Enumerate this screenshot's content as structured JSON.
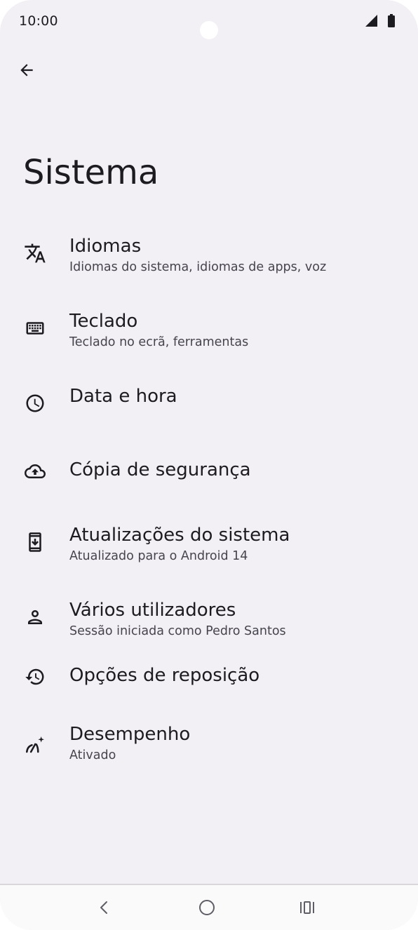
{
  "status_bar": {
    "time": "10:00",
    "icons": [
      "signal-icon",
      "battery-icon"
    ]
  },
  "header": {
    "back_icon": "arrow-back-icon",
    "title": "Sistema"
  },
  "settings": [
    {
      "id": "idiomas",
      "icon": "translate-icon",
      "title": "Idiomas",
      "summary": "Idiomas do sistema, idiomas de apps, voz"
    },
    {
      "id": "teclado",
      "icon": "keyboard-icon",
      "title": "Teclado",
      "summary": "Teclado no ecrã, ferramentas"
    },
    {
      "id": "data-hora",
      "icon": "clock-icon",
      "title": "Data e hora",
      "summary": ""
    },
    {
      "id": "copia-seguranca",
      "icon": "cloud-upload-icon",
      "title": "Cópia de segurança",
      "summary": ""
    },
    {
      "id": "atualizacoes",
      "icon": "system-update-icon",
      "title": "Atualizações do sistema",
      "summary": "Atualizado para o Android 14"
    },
    {
      "id": "varios-utilizadores",
      "icon": "person-icon",
      "title": "Vários utilizadores",
      "summary": "Sessão iniciada como Pedro Santos"
    },
    {
      "id": "opcoes-reposicao",
      "icon": "history-icon",
      "title": "Opções de reposição",
      "summary": ""
    },
    {
      "id": "desempenho",
      "icon": "speed-sparkle-icon",
      "title": "Desempenho",
      "summary": "Ativado"
    }
  ],
  "nav_bar": {
    "buttons": [
      "back-nav-icon",
      "home-nav-icon",
      "recents-nav-icon"
    ]
  },
  "colors": {
    "background": "#f2eff5",
    "text_primary": "#1c1b1f",
    "text_secondary": "#46454d"
  }
}
